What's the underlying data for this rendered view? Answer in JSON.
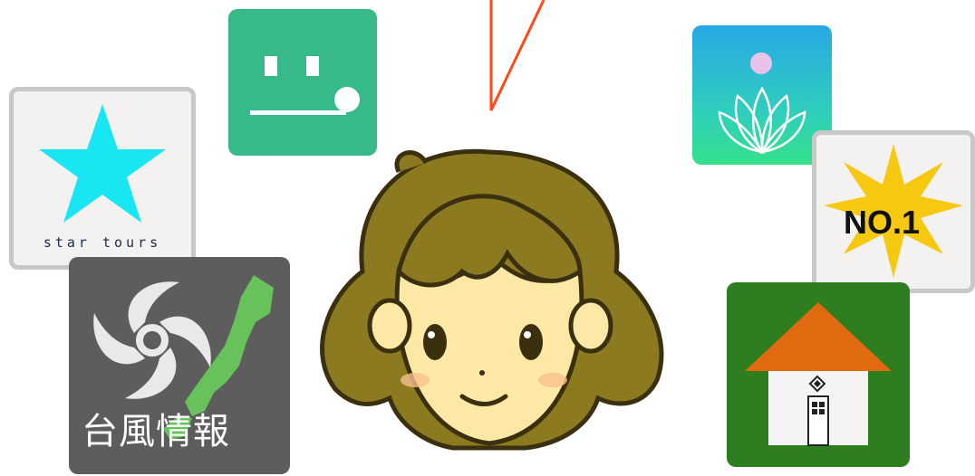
{
  "scene": {
    "description_tags": [
      "girl-face",
      "app-icons"
    ]
  },
  "apps": {
    "star_tours": {
      "label": "star tours",
      "icon": "star-icon",
      "star_color": "#18e6f2"
    },
    "typhoon_info": {
      "label": "台風情報",
      "icon": "typhoon-icon",
      "bg_color": "#5d5d5d",
      "map_color": "#67c25c"
    },
    "no1": {
      "label": "NO.1",
      "icon": "starburst-icon",
      "burst_color": "#f6c80f"
    },
    "chat": {
      "icon": "face-dots-icon",
      "bg_color": "#37b98a"
    },
    "lotus": {
      "icon": "lotus-icon"
    },
    "home": {
      "icon": "house-icon",
      "bg_color": "#2e7d1e",
      "roof_color": "#e06a10"
    }
  },
  "decorations": {
    "line_color": "#ff4a18"
  }
}
